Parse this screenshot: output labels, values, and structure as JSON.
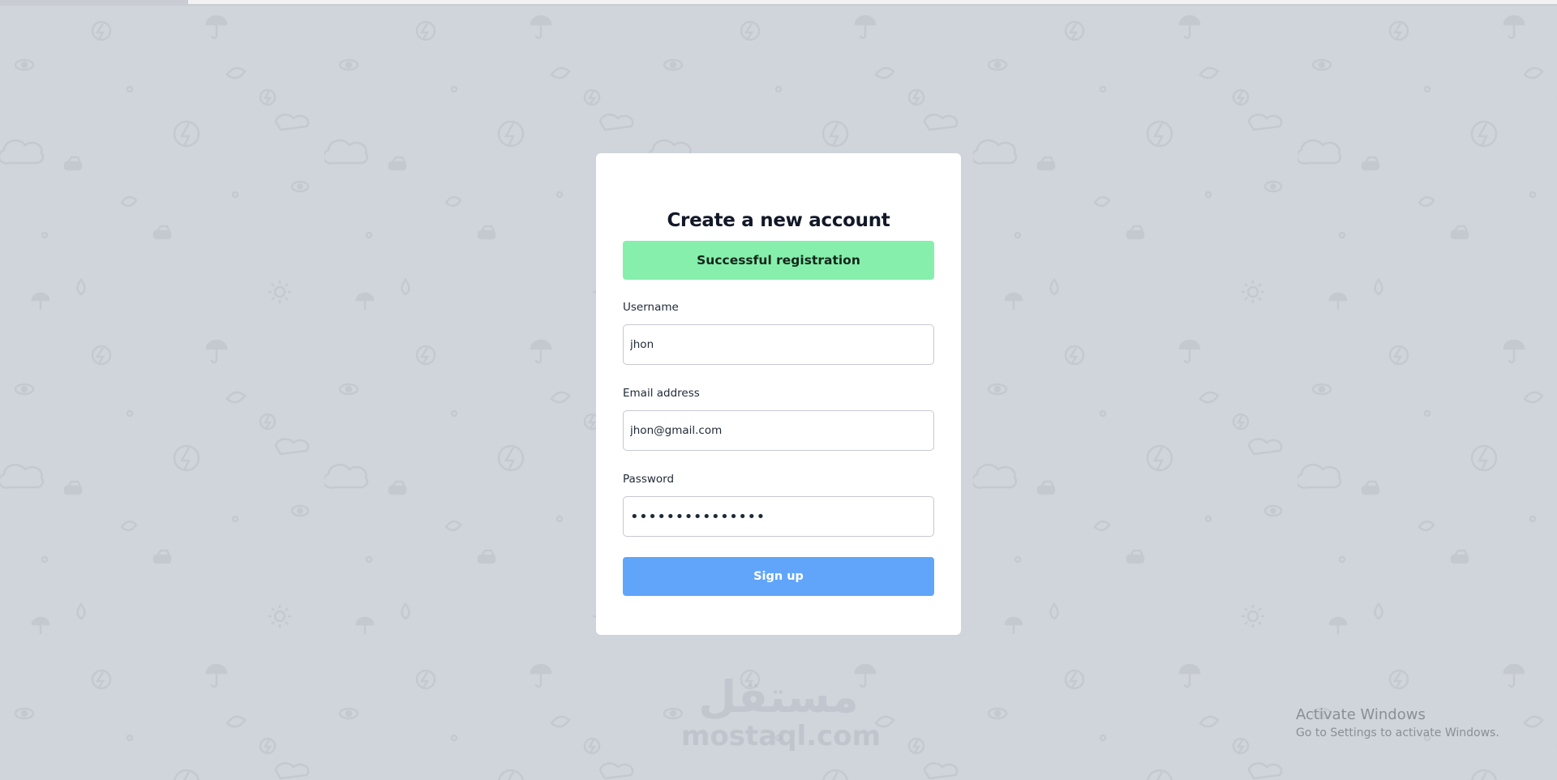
{
  "form": {
    "title": "Create a new account",
    "alert_message": "Successful registration",
    "username_label": "Username",
    "username_value": "jhon",
    "email_label": "Email address",
    "email_value": "jhon@gmail.com",
    "password_label": "Password",
    "password_value": "jhonpassword123",
    "submit_label": "Sign up"
  },
  "watermark": {
    "logo_text": "مستقل",
    "url": "mostaql.com"
  },
  "windows_notice": {
    "title": "Activate Windows",
    "subtitle": "Go to Settings to activate Windows."
  },
  "colors": {
    "background": "#d0d4db",
    "card": "#ffffff",
    "success_alert": "#86efac",
    "button": "#60a5fa",
    "title_text": "#111827"
  },
  "background_icons": [
    "eye-icon",
    "car-icon",
    "bolt-icon",
    "cloud-icon",
    "umbrella-icon",
    "sun-icon",
    "drop-icon",
    "leaf-icon"
  ]
}
